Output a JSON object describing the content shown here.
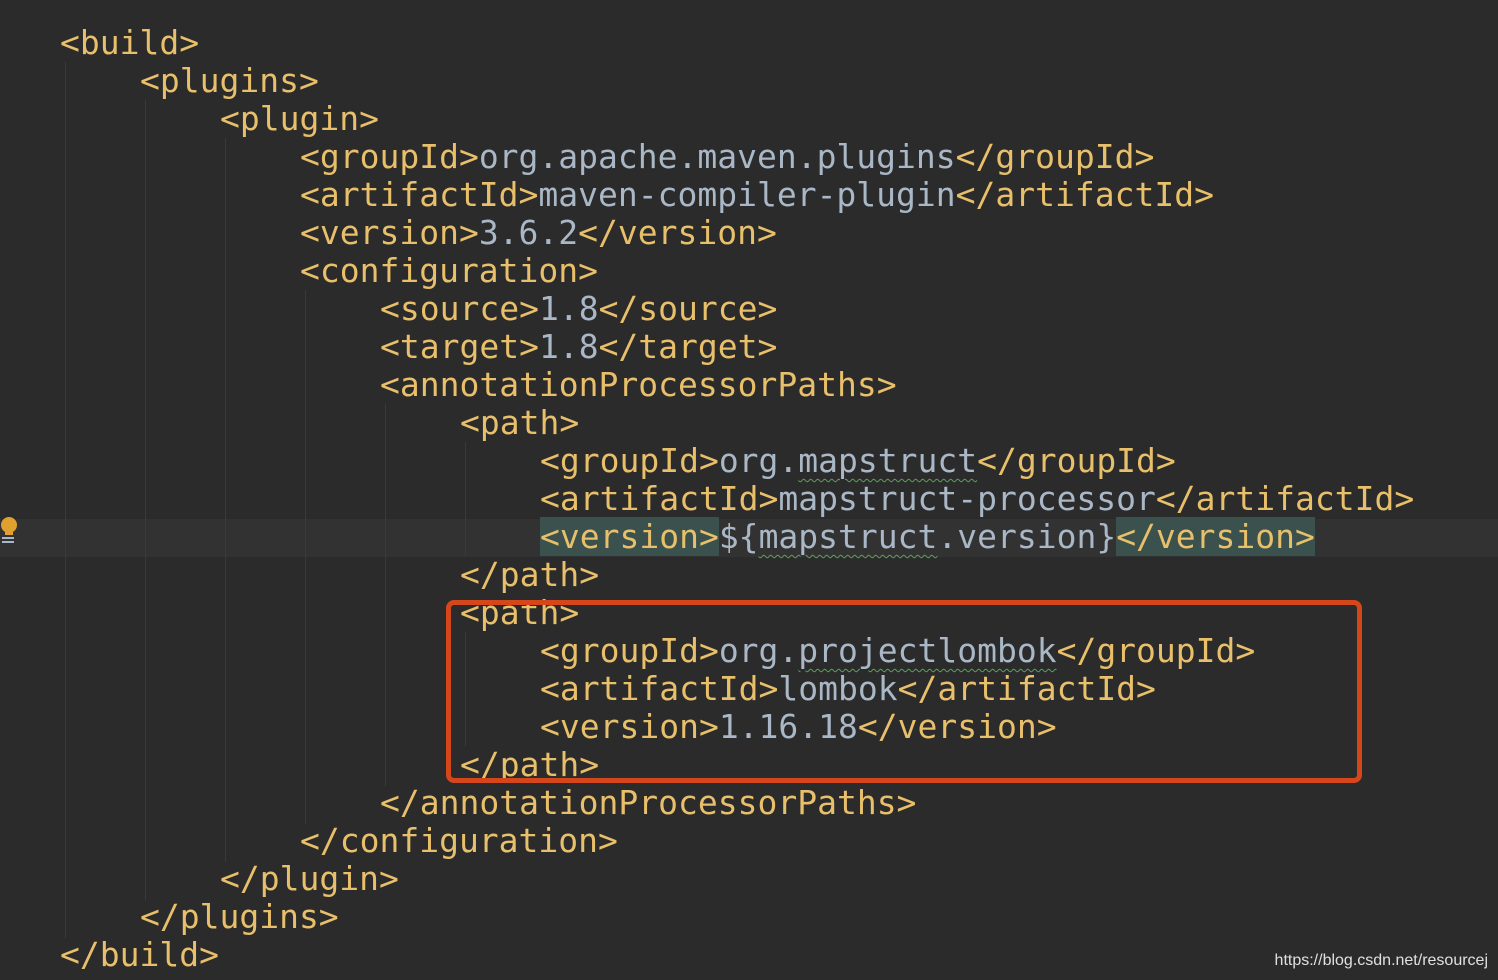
{
  "lines": [
    {
      "indent": 0,
      "open": "<build>"
    },
    {
      "indent": 1,
      "open": "<plugins>"
    },
    {
      "indent": 2,
      "open": "<plugin>"
    },
    {
      "indent": 3,
      "open": "<groupId>",
      "value": "org.apache.maven.plugins",
      "close": "</groupId>"
    },
    {
      "indent": 3,
      "open": "<artifactId>",
      "value": "maven-compiler-plugin",
      "close": "</artifactId>"
    },
    {
      "indent": 3,
      "open": "<version>",
      "value": "3.6.2",
      "close": "</version>"
    },
    {
      "indent": 3,
      "open": "<configuration>"
    },
    {
      "indent": 4,
      "open": "<source>",
      "value": "1.8",
      "close": "</source>"
    },
    {
      "indent": 4,
      "open": "<target>",
      "value": "1.8",
      "close": "</target>"
    },
    {
      "indent": 4,
      "open": "<annotationProcessorPaths>"
    },
    {
      "indent": 5,
      "open": "<path>"
    },
    {
      "indent": 6,
      "open": "<groupId>",
      "value_prefix": "org.",
      "value_squiggle": "mapstruct",
      "close": "</groupId>"
    },
    {
      "indent": 6,
      "open": "<artifactId>",
      "value": "mapstruct-processor",
      "close": "</artifactId>"
    },
    {
      "indent": 6,
      "open": "<version>",
      "value_prefix": "${",
      "value_squiggle": "mapstruct",
      "value_suffix": ".version}",
      "close": "</version>"
    },
    {
      "indent": 5,
      "open": "</path>"
    },
    {
      "indent": 5,
      "open": "<path>"
    },
    {
      "indent": 6,
      "open": "<groupId>",
      "value_prefix": "org.",
      "value_squiggle": "projectlombok",
      "close": "</groupId>"
    },
    {
      "indent": 6,
      "open": "<artifactId>",
      "value": "lombok",
      "close": "</artifactId>"
    },
    {
      "indent": 6,
      "open": "<version>",
      "value": "1.16.18",
      "close": "</version>"
    },
    {
      "indent": 5,
      "open": "</path>"
    },
    {
      "indent": 4,
      "open": "</annotationProcessorPaths>"
    },
    {
      "indent": 3,
      "open": "</configuration>"
    },
    {
      "indent": 2,
      "open": "</plugin>"
    },
    {
      "indent": 1,
      "open": "</plugins>"
    },
    {
      "indent": 0,
      "open": "</build>"
    }
  ],
  "caret_line_index": 13,
  "highlight_box_note": "",
  "watermark": "https://blog.csdn.net/resourcej",
  "colors": {
    "background": "#2b2b2b",
    "tag": "#e8bf6a",
    "text": "#a9b7c6",
    "match_highlight": "#3b514d",
    "annotation_box": "#d5471b",
    "bulb": "#e0a030"
  },
  "icons": {
    "gutter": "lightbulb-icon"
  }
}
